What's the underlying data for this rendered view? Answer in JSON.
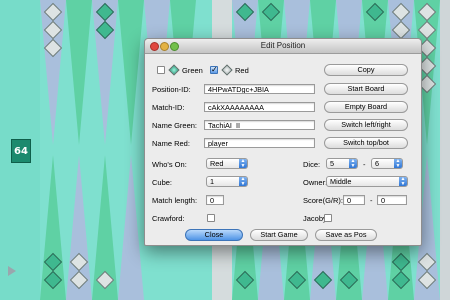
{
  "board": {
    "cube_value": "64",
    "colors": {
      "felt": "#7fe0cf",
      "point_blue": "#a9bfdc",
      "point_green": "#5fd1a4",
      "bar": "#cfd6d8"
    }
  },
  "dialog": {
    "title": "Edit Position",
    "green_label": "Green",
    "red_label": "Red",
    "green_checked": false,
    "red_checked": true,
    "copy_button": "Copy",
    "position_id_label": "Position-ID:",
    "position_id_value": "4HPwATDgc+JBIA",
    "start_board_button": "Start Board",
    "match_id_label": "Match-ID:",
    "match_id_value": "cAkXAAAAAAAA",
    "empty_board_button": "Empty Board",
    "name_green_label": "Name Green:",
    "name_green_value": "TachiAI_II",
    "switch_lr_button": "Switch left/right",
    "name_red_label": "Name Red:",
    "name_red_value": "player",
    "switch_tb_button": "Switch top/bot",
    "whos_on_label": "Who's On:",
    "whos_on_value": "Red",
    "dice_label": "Dice:",
    "dice_1": "5",
    "dice_sep": "-",
    "dice_2": "6",
    "cube_label": "Cube:",
    "cube_value": "1",
    "owner_label": "Owner:",
    "owner_value": "Middle",
    "match_length_label": "Match length:",
    "match_length_value": "0",
    "score_label": "Score(G/R):",
    "score_green": "0",
    "score_sep": "-",
    "score_red": "0",
    "crawford_label": "Crawford:",
    "jacoby_label": "Jacoby:",
    "close_button": "Close",
    "start_game_button": "Start Game",
    "save_as_pos_button": "Save as Pos"
  }
}
